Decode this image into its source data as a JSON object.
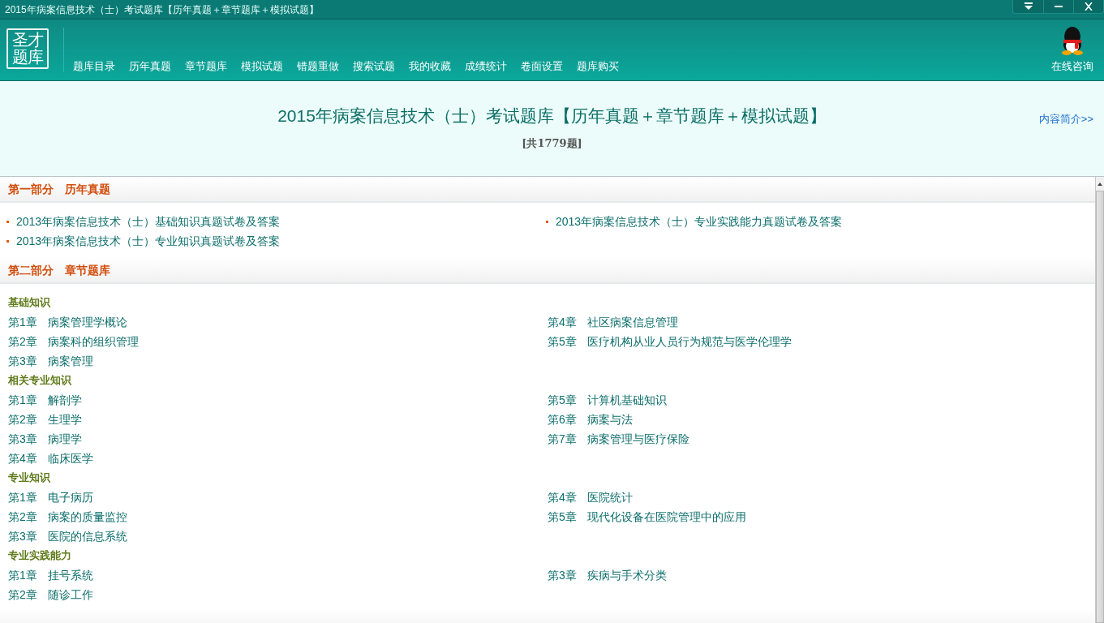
{
  "window": {
    "title": "2015年病案信息技术（士）考试题库【历年真题＋章节题库＋模拟试题】",
    "controls": [
      {
        "kind": "dropdown"
      },
      {
        "kind": "minimize"
      },
      {
        "kind": "close"
      }
    ]
  },
  "logo": {
    "lines": [
      "圣才",
      "题库"
    ]
  },
  "nav": {
    "items": [
      {
        "label": "题库目录"
      },
      {
        "label": "历年真题"
      },
      {
        "label": "章节题库"
      },
      {
        "label": "模拟试题"
      },
      {
        "label": "错题重做"
      },
      {
        "label": "搜索试题"
      },
      {
        "label": "我的收藏"
      },
      {
        "label": "成绩统计"
      },
      {
        "label": "卷面设置"
      },
      {
        "label": "题库购买"
      }
    ],
    "consult": "在线咨询"
  },
  "header": {
    "title": "2015年病案信息技术（士）考试题库【历年真题＋章节题库＋模拟试题】",
    "count": "[共1779题]",
    "intro_link": "内容简介>>"
  },
  "sections": [
    {
      "kind": "links",
      "title": "第一部分　历年真题",
      "links": [
        {
          "text": "2013年病案信息技术（士）基础知识真题试卷及答案"
        },
        {
          "text": "2013年病案信息技术（士）专业实践能力真题试卷及答案"
        },
        {
          "text": "2013年病案信息技术（士）专业知识真题试卷及答案"
        }
      ]
    },
    {
      "kind": "chapters",
      "title": "第二部分　章节题库",
      "groups": [
        {
          "title": "基础知识",
          "left": [
            {
              "num": "第1章",
              "name": "病案管理学概论"
            },
            {
              "num": "第2章",
              "name": "病案科的组织管理"
            },
            {
              "num": "第3章",
              "name": "病案管理"
            }
          ],
          "right": [
            {
              "num": "第4章",
              "name": "社区病案信息管理"
            },
            {
              "num": "第5章",
              "name": "医疗机构从业人员行为规范与医学伦理学"
            }
          ]
        },
        {
          "title": "相关专业知识",
          "left": [
            {
              "num": "第1章",
              "name": "解剖学"
            },
            {
              "num": "第2章",
              "name": "生理学"
            },
            {
              "num": "第3章",
              "name": "病理学"
            },
            {
              "num": "第4章",
              "name": "临床医学"
            }
          ],
          "right": [
            {
              "num": "第5章",
              "name": "计算机基础知识"
            },
            {
              "num": "第6章",
              "name": "病案与法"
            },
            {
              "num": "第7章",
              "name": "病案管理与医疗保险"
            }
          ]
        },
        {
          "title": "专业知识",
          "left": [
            {
              "num": "第1章",
              "name": "电子病历"
            },
            {
              "num": "第2章",
              "name": "病案的质量监控"
            },
            {
              "num": "第3章",
              "name": "医院的信息系统"
            }
          ],
          "right": [
            {
              "num": "第4章",
              "name": "医院统计"
            },
            {
              "num": "第5章",
              "name": "现代化设备在医院管理中的应用"
            }
          ]
        },
        {
          "title": "专业实践能力",
          "left": [
            {
              "num": "第1章",
              "name": "挂号系统"
            },
            {
              "num": "第2章",
              "name": "随诊工作"
            }
          ],
          "right": [
            {
              "num": "第3章",
              "name": "疾病与手术分类"
            }
          ]
        }
      ]
    },
    {
      "kind": "cut"
    }
  ]
}
